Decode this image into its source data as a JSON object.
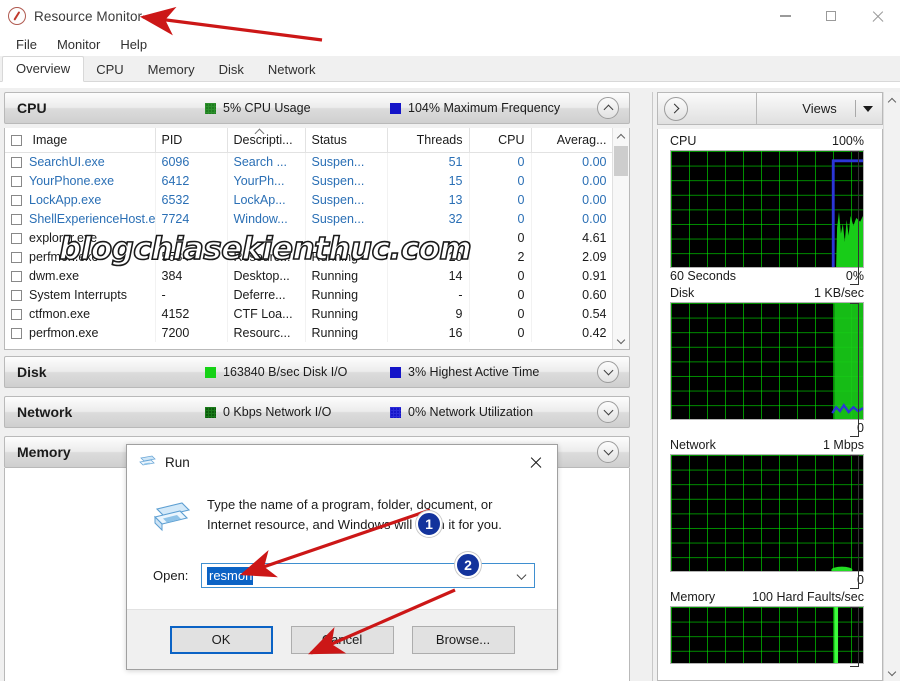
{
  "window": {
    "title": "Resource Monitor",
    "app_icon": "resource-monitor-icon",
    "minimize": "–",
    "maximize": "□",
    "close": "✕"
  },
  "menubar": {
    "items": [
      "File",
      "Monitor",
      "Help"
    ]
  },
  "tabs": {
    "items": [
      "Overview",
      "CPU",
      "Memory",
      "Disk",
      "Network"
    ],
    "active": "Overview"
  },
  "sections": {
    "cpu": {
      "name": "CPU",
      "stat1": "5% CPU Usage",
      "stat2": "104% Maximum Frequency",
      "stat1_color": "#1e7d1e",
      "stat2_color": "#1414c8",
      "expanded": true,
      "chevron": "chevron-up"
    },
    "disk": {
      "name": "Disk",
      "stat1": "163840 B/sec Disk I/O",
      "stat2": "3% Highest Active Time",
      "stat1_color": "#16d216",
      "stat2_color": "#1414c8",
      "expanded": false,
      "chevron": "chevron-down"
    },
    "network": {
      "name": "Network",
      "stat1": "0 Kbps Network I/O",
      "stat2": "0% Network Utilization",
      "stat1_color": "#0c5c0c",
      "stat2_color": "#1414c8",
      "expanded": false,
      "chevron": "chevron-down"
    },
    "memory": {
      "name": "Memory",
      "stat1": "",
      "stat2": "",
      "expanded": false,
      "chevron": "chevron-down"
    }
  },
  "process_table": {
    "columns": [
      "Image",
      "PID",
      "Descripti...",
      "Status",
      "Threads",
      "CPU",
      "Averag..."
    ],
    "sorted_column": "Descripti...",
    "rows": [
      {
        "image": "SearchUI.exe",
        "pid": "6096",
        "description": "Search ...",
        "status": "Suspen...",
        "threads": "51",
        "cpu": "0",
        "average": "0.00",
        "suspended": true
      },
      {
        "image": "YourPhone.exe",
        "pid": "6412",
        "description": "YourPh...",
        "status": "Suspen...",
        "threads": "15",
        "cpu": "0",
        "average": "0.00",
        "suspended": true
      },
      {
        "image": "LockApp.exe",
        "pid": "6532",
        "description": "LockAp...",
        "status": "Suspen...",
        "threads": "13",
        "cpu": "0",
        "average": "0.00",
        "suspended": true
      },
      {
        "image": "ShellExperienceHost.exe",
        "pid": "7724",
        "description": "Window...",
        "status": "Suspen...",
        "threads": "32",
        "cpu": "0",
        "average": "0.00",
        "suspended": true
      },
      {
        "image": "explorer.exe",
        "pid": "",
        "description": "",
        "status": "",
        "threads": "",
        "cpu": "0",
        "average": "4.61",
        "suspended": false
      },
      {
        "image": "perfmon.exe",
        "pid": "5584",
        "description": "Resourc...",
        "status": "Running",
        "threads": "20",
        "cpu": "2",
        "average": "2.09",
        "suspended": false
      },
      {
        "image": "dwm.exe",
        "pid": "384",
        "description": "Desktop...",
        "status": "Running",
        "threads": "14",
        "cpu": "0",
        "average": "0.91",
        "suspended": false
      },
      {
        "image": "System Interrupts",
        "pid": "-",
        "description": "Deferre...",
        "status": "Running",
        "threads": "-",
        "cpu": "0",
        "average": "0.60",
        "suspended": false
      },
      {
        "image": "ctfmon.exe",
        "pid": "4152",
        "description": "CTF Loa...",
        "status": "Running",
        "threads": "9",
        "cpu": "0",
        "average": "0.54",
        "suspended": false
      },
      {
        "image": "perfmon.exe",
        "pid": "7200",
        "description": "Resourc...",
        "status": "Running",
        "threads": "16",
        "cpu": "0",
        "average": "0.42",
        "suspended": false
      }
    ]
  },
  "right_panel": {
    "expand_button": "chevron-right-icon",
    "views_label": "Views",
    "views_dropdown": "chevron-down-icon",
    "graphs": [
      {
        "name": "CPU",
        "top_right": "100%",
        "bottom_left": "60 Seconds",
        "bottom_right": "0%"
      },
      {
        "name": "Disk",
        "top_right": "1 KB/sec",
        "bottom_left": "",
        "bottom_right": "0"
      },
      {
        "name": "Network",
        "top_right": "1 Mbps",
        "bottom_left": "",
        "bottom_right": "0"
      },
      {
        "name": "Memory",
        "top_right": "100 Hard Faults/sec",
        "bottom_left": "",
        "bottom_right": ""
      }
    ]
  },
  "run_dialog": {
    "title": "Run",
    "icon": "run-window-icon",
    "close": "✕",
    "description": "Type the name of a program, folder, document, or Internet resource, and Windows will open it for you.",
    "open_label": "Open:",
    "value": "resmon",
    "placeholder": "",
    "buttons": {
      "ok": "OK",
      "cancel": "Cancel",
      "browse": "Browse..."
    }
  },
  "annotations": {
    "badges": [
      {
        "number": "1"
      },
      {
        "number": "2"
      }
    ],
    "arrow_color": "#cc1717"
  },
  "watermark": {
    "text": "blogchiasekienthuc.com"
  }
}
